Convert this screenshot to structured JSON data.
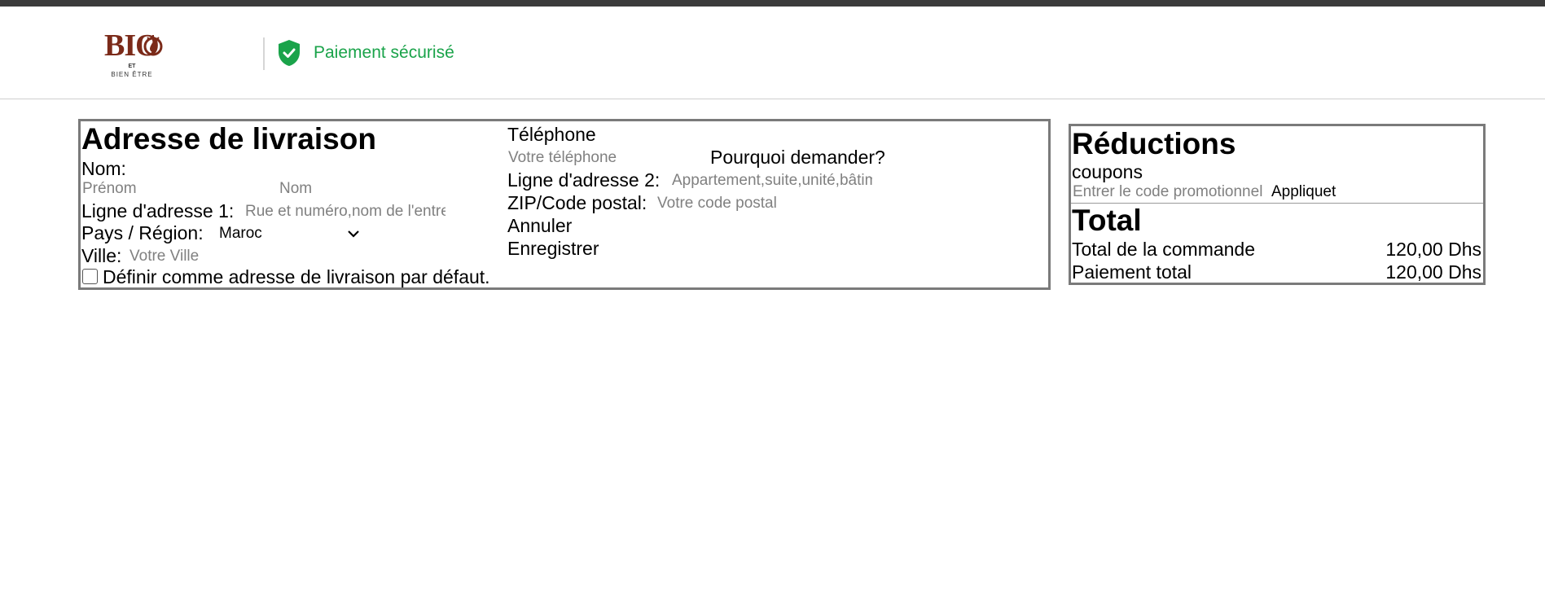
{
  "header": {
    "logo_main": "BIO",
    "logo_et": "ET",
    "logo_sub": "BIEN ÊTRE",
    "secure_label": "Paiement sécurisé",
    "secure_color": "#1aa34a",
    "brand_color": "#7b2a19",
    "secure_icon": "shield-check-icon"
  },
  "address": {
    "title": "Adresse de livraison",
    "name_label": "Nom:",
    "first_name_placeholder": "Prénom",
    "last_name_placeholder": "Nom",
    "address1_label": "Ligne d'adresse 1:",
    "address1_placeholder": "Rue et numéro,nom de l'entreprise",
    "country_label": "Pays / Région:",
    "country_value": "Maroc",
    "city_label": "Ville:",
    "city_placeholder": "Votre Ville",
    "default_checkbox_label": "Définir comme adresse de livraison par défaut.",
    "default_checked": false,
    "phone_label": "Téléphone",
    "phone_placeholder": "Votre téléphone",
    "why_ask": "Pourquoi demander?",
    "address2_label": "Ligne d'adresse 2:",
    "address2_placeholder": "Appartement,suite,unité,bâtiment",
    "zip_label": "ZIP/Code postal:",
    "zip_placeholder": "Votre code postal",
    "cancel_label": "Annuler",
    "save_label": "Enregistrer"
  },
  "reductions": {
    "title": "Réductions",
    "coupons_label": "coupons",
    "promo_placeholder": "Entrer le code promotionnel",
    "apply_label": "Appliquet",
    "total_title": "Total",
    "order_total_label": "Total de la commande",
    "order_total_value": "120,00 Dhs",
    "payment_total_label": "Paiement total",
    "payment_total_value": "120,00 Dhs"
  }
}
